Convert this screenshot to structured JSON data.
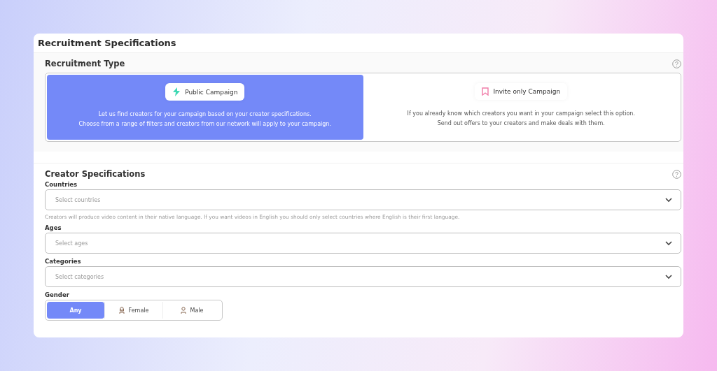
{
  "title": "Recruitment Specifications",
  "recruitment_type": {
    "heading": "Recruitment Type",
    "options": [
      {
        "label": "Public Campaign",
        "kind": "bolt",
        "selected": true,
        "lines": [
          "Let us find creators for your campaign based on your creator specifications.",
          "Choose from a range of filters and creators from our network will apply to your campaign."
        ]
      },
      {
        "label": "Invite only Campaign",
        "kind": "bookmark",
        "selected": false,
        "lines": [
          "If you already know which creators you want in your campaign select this option.",
          "Send out offers to your creators and make deals with them."
        ]
      }
    ]
  },
  "creator_specifications": {
    "heading": "Creator Specifications",
    "fields": [
      {
        "label": "Countries",
        "placeholder": "Select countries",
        "hint": "Creators will produce video content in their native language. If you want videos in English you should only select countries where English is their first language."
      },
      {
        "label": "Ages",
        "placeholder": "Select ages"
      },
      {
        "label": "Categories",
        "placeholder": "Select categories"
      }
    ],
    "gender": {
      "label": "Gender",
      "options": [
        {
          "label": "Any",
          "kind": "plain",
          "selected": true
        },
        {
          "label": "Female",
          "kind": "female",
          "selected": false
        },
        {
          "label": "Male",
          "kind": "male",
          "selected": false
        }
      ]
    }
  }
}
